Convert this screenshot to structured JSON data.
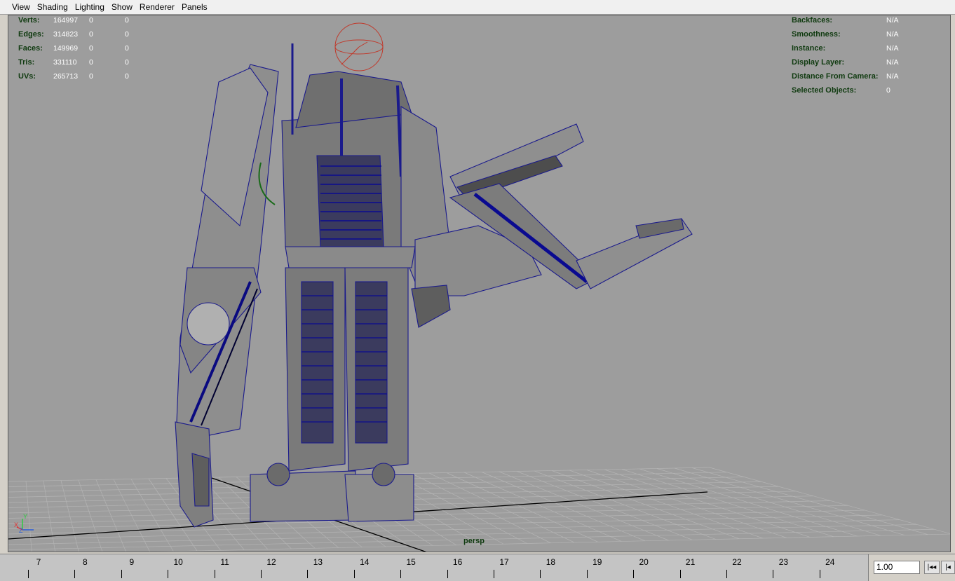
{
  "menu": [
    "View",
    "Shading",
    "Lighting",
    "Show",
    "Renderer",
    "Panels"
  ],
  "hud_left": [
    {
      "label": "Verts:",
      "values": [
        "164997",
        "0",
        "0"
      ]
    },
    {
      "label": "Edges:",
      "values": [
        "314823",
        "0",
        "0"
      ]
    },
    {
      "label": "Faces:",
      "values": [
        "149969",
        "0",
        "0"
      ]
    },
    {
      "label": "Tris:",
      "values": [
        "331110",
        "0",
        "0"
      ]
    },
    {
      "label": "UVs:",
      "values": [
        "265713",
        "0",
        "0"
      ]
    }
  ],
  "hud_right": [
    {
      "label": "Backfaces:",
      "value": "N/A"
    },
    {
      "label": "Smoothness:",
      "value": "N/A"
    },
    {
      "label": "Instance:",
      "value": "N/A"
    },
    {
      "label": "Display Layer:",
      "value": "N/A"
    },
    {
      "label": "Distance From Camera:",
      "value": "N/A"
    },
    {
      "label": "Selected Objects:",
      "value": "0"
    }
  ],
  "camera_name": "persp",
  "axis": {
    "x": "X",
    "y": "Y",
    "z": "Z"
  },
  "timeline": {
    "frames": [
      "7",
      "8",
      "9",
      "10",
      "11",
      "12",
      "13",
      "14",
      "15",
      "16",
      "17",
      "18",
      "19",
      "20",
      "21",
      "22",
      "23",
      "24"
    ],
    "current_time": "1.00",
    "buttons": {
      "go_to_start": "|◂◂",
      "step_back": "|◂"
    }
  },
  "colors": {
    "viewport_bg": "#9d9d9d",
    "wire": "#1a1a8c",
    "hud_label": "#0f3a0f",
    "manipulator": "#c0392b"
  }
}
